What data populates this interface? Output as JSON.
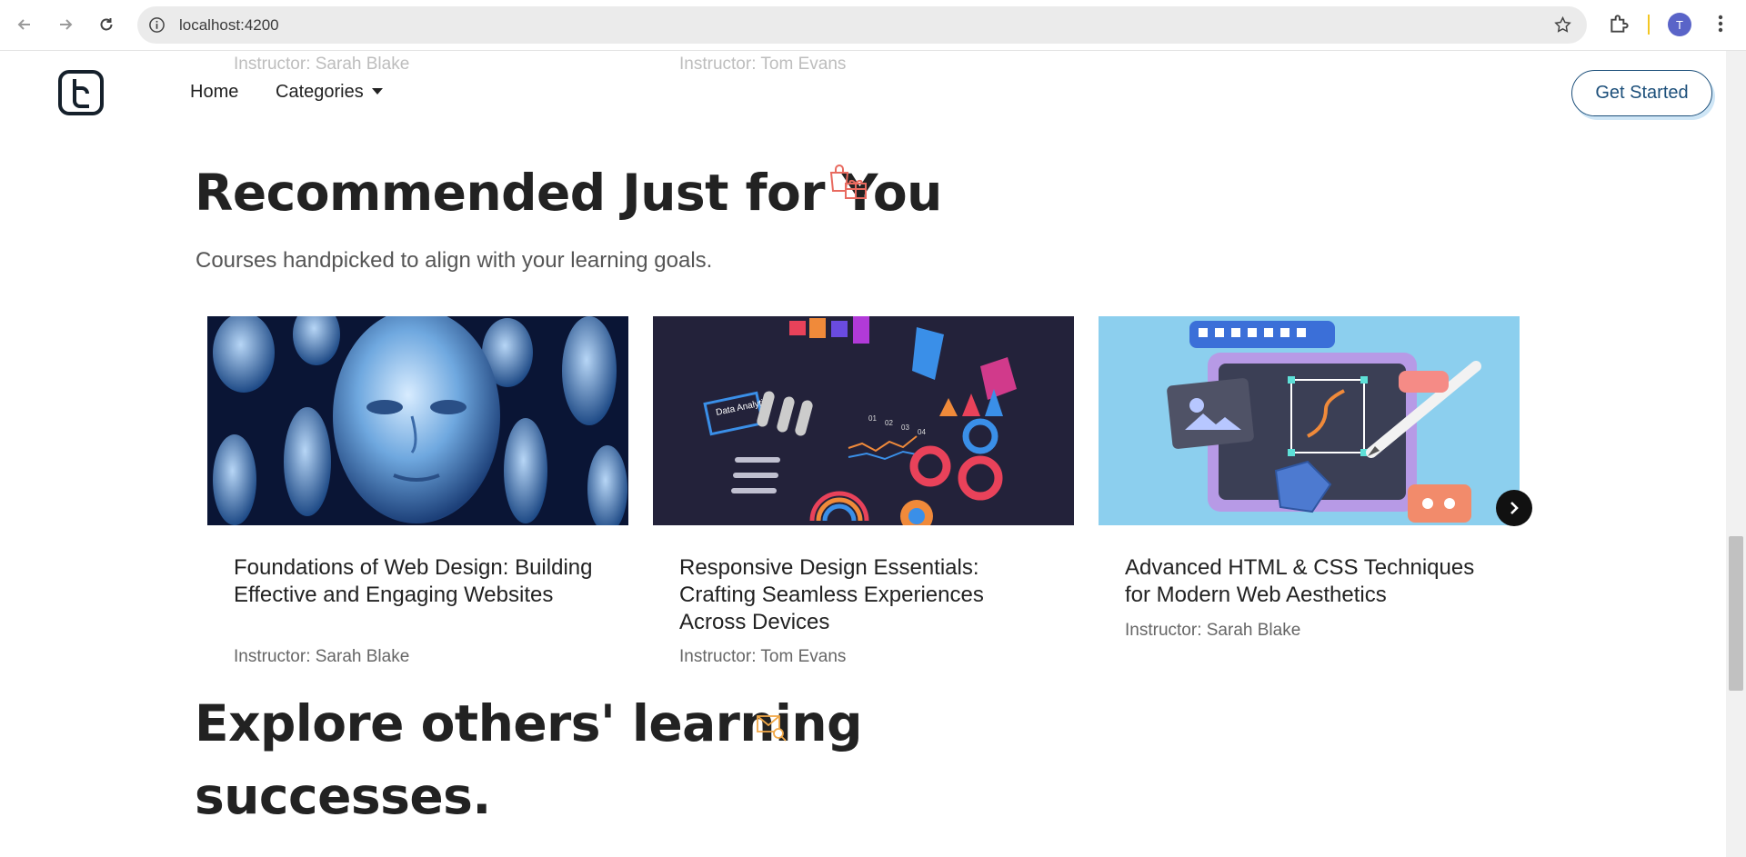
{
  "browser": {
    "url": "localhost:4200",
    "profile_initial": "T"
  },
  "ghost_instructors": [
    "Instructor: Sarah Blake",
    "Instructor: Tom Evans"
  ],
  "header": {
    "nav": {
      "home": "Home",
      "categories": "Categories"
    },
    "cta": "Get Started"
  },
  "recommended": {
    "title": "Recommended Just for You",
    "subtitle": "Courses handpicked to align with your learning goals.",
    "cards": [
      {
        "title": "Foundations of Web Design: Building Effective and Engaging Websites",
        "instructor": "Instructor: Sarah Blake"
      },
      {
        "title": "Responsive Design Essentials: Crafting Seamless Experiences Across Devices",
        "instructor": "Instructor: Tom Evans"
      },
      {
        "title": "Advanced HTML & CSS Techniques for Modern Web Aesthetics",
        "instructor": "Instructor: Sarah Blake"
      }
    ],
    "img2_label": "Data Analytics",
    "img2_ticks": [
      "01",
      "02",
      "03",
      "04"
    ]
  },
  "explore": {
    "line1": "Explore others' learning",
    "line2": "successes."
  },
  "colors": {
    "accent": "#1c4f7a",
    "icon_red": "#e86a5f",
    "icon_orange": "#f0a848"
  }
}
